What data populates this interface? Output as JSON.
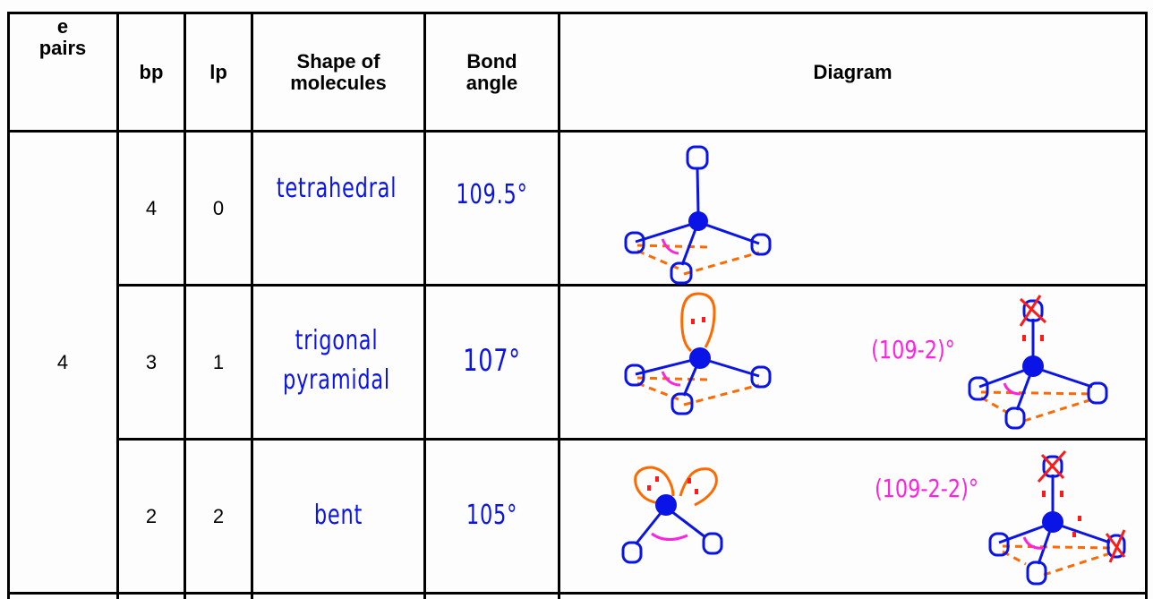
{
  "table": {
    "headers": {
      "e_pairs": "e\npairs",
      "e_pairs_line1": "e",
      "e_pairs_line2": "pairs",
      "bp": "bp",
      "lp": "lp",
      "shape": "Shape of molecules",
      "shape_line1": "Shape of",
      "shape_line2": "molecules",
      "bond_angle_line1": "Bond",
      "bond_angle_line2": "angle",
      "diagram": "Diagram"
    },
    "e_pairs_value": "4",
    "rows": [
      {
        "bp": "4",
        "lp": "0",
        "shape_lines": [
          "tetrahedral"
        ],
        "bond_angle": "109.5°",
        "diagram": {
          "lone_pairs": 0,
          "annotation": ""
        }
      },
      {
        "bp": "3",
        "lp": "1",
        "shape_lines": [
          "trigonal",
          "pyramidal"
        ],
        "bond_angle": "107°",
        "diagram": {
          "lone_pairs": 1,
          "annotation": "(109-2)°"
        }
      },
      {
        "bp": "2",
        "lp": "2",
        "shape_lines": [
          "bent"
        ],
        "bond_angle": "105°",
        "diagram": {
          "lone_pairs": 2,
          "annotation": "(109-2-2)°"
        }
      }
    ]
  },
  "colors": {
    "ink_blue": "#0a14e6",
    "ink_orange": "#ff6a00",
    "ink_red": "#ff1a1a",
    "ink_pink": "#ff22e0",
    "grid": "#000000"
  }
}
